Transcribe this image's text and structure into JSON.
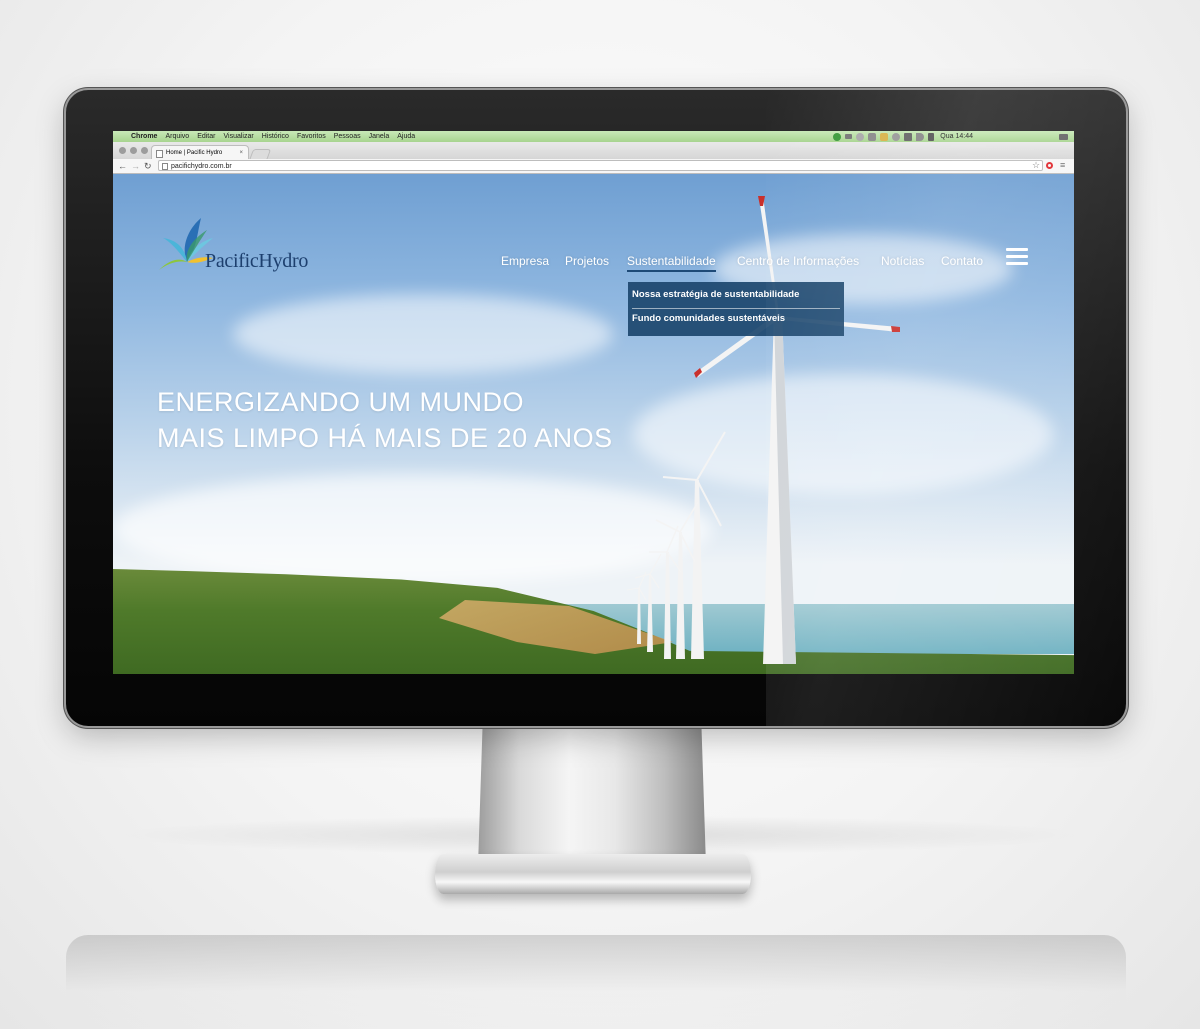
{
  "menubar": {
    "app": "Chrome",
    "items": [
      "Arquivo",
      "Editar",
      "Visualizar",
      "Histórico",
      "Favoritos",
      "Pessoas",
      "Janela",
      "Ajuda"
    ],
    "clock": "Qua 14:44"
  },
  "browser": {
    "tab_title": "Home | Pacific Hydro",
    "tab_close": "×",
    "url": "pacifichydro.com.br"
  },
  "site": {
    "logo_text": "PacificHydro",
    "nav": [
      "Empresa",
      "Projetos",
      "Sustentabilidade",
      "Centro de Informações",
      "Notícias",
      "Contato"
    ],
    "active_nav": "Sustentabilidade",
    "dropdown": [
      "Nossa estratégia de sustentabilidade",
      "Fundo comunidades sustentáveis"
    ],
    "headline_line1": "ENERGIZANDO UM MUNDO",
    "headline_line2": "MAIS LIMPO HÁ MAIS DE 20 ANOS"
  },
  "colors": {
    "nav_active_underline": "#1e4a77",
    "dropdown_bg": "#1c466e",
    "menubar_bg": "#b9dfa5",
    "opera_red": "#e0262b"
  }
}
